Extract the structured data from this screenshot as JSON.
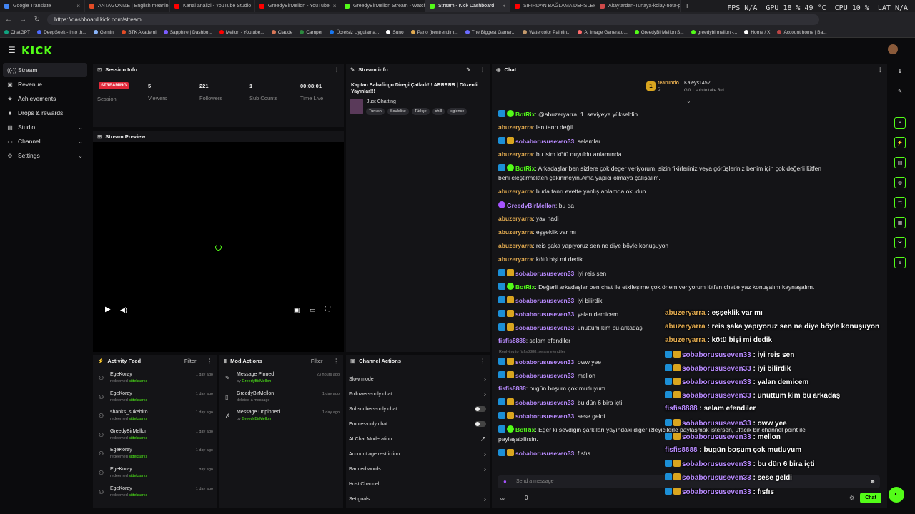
{
  "browser": {
    "tabs": [
      {
        "label": "Google Translate",
        "color": "#4285f4"
      },
      {
        "label": "ANTAGONIZE | English meaning -",
        "color": "#e34c26"
      },
      {
        "label": "Kanal analizi - YouTube Studio",
        "color": "#ff0000"
      },
      {
        "label": "GreedyBirMellon - YouTube",
        "color": "#ff0000"
      },
      {
        "label": "GreedyBirMellon Stream - Watch",
        "color": "#53fc18"
      },
      {
        "label": "Stream - Kick Dashboard",
        "color": "#53fc18",
        "active": true
      },
      {
        "label": "SIFIRDAN BAĞLAMA DERSLERİ 6 (",
        "color": "#ff0000"
      },
      {
        "label": "Altaylardan-Tunaya-kolay-nota-p",
        "color": "#d04a4a"
      }
    ],
    "url": "https://dashboard.kick.com/stream",
    "perf": {
      "fps_label": "FPS",
      "fps": "N/A",
      "gpu_label": "GPU",
      "gpu": "18 % 49 °C",
      "cpu_label": "CPU",
      "cpu": "10 %",
      "lat_label": "LAT",
      "lat": "N/A"
    },
    "bookmarks": [
      "ChatGPT",
      "DeepSeek - Into th...",
      "Gemini",
      "BTK Akademi",
      "Sapphire | Dashbo...",
      "Mellon - Youtube...",
      "Claude",
      "Camper",
      "Ücretsiz Uygulama...",
      "Suno",
      "Pano (bentrendim...",
      "The Biggest Gamer...",
      "Watercolor Paintin...",
      "AI Image Generato...",
      "GreedyBirMellon S...",
      "greedybirmellon -...",
      "Home / X",
      "Account home | Ba..."
    ]
  },
  "kick": {
    "logo": "KICK"
  },
  "sidebar": {
    "items": [
      {
        "label": "Stream",
        "icon": "radio-icon",
        "glyph": "((·))",
        "active": true
      },
      {
        "label": "Revenue",
        "icon": "dollar-icon",
        "glyph": "▣"
      },
      {
        "label": "Achievements",
        "icon": "trophy-icon",
        "glyph": "★"
      },
      {
        "label": "Drops & rewards",
        "icon": "gift-icon",
        "glyph": "■"
      },
      {
        "label": "Studio",
        "icon": "studio-icon",
        "glyph": "▤",
        "chevron": true
      },
      {
        "label": "Channel",
        "icon": "channel-icon",
        "glyph": "▭",
        "chevron": true
      },
      {
        "label": "Settings",
        "icon": "gear-icon",
        "glyph": "⚙",
        "chevron": true
      }
    ]
  },
  "session": {
    "title": "Session Info",
    "badge": "STREAMING",
    "session_label": "Session",
    "stats": [
      {
        "value": "5",
        "label": "Viewers"
      },
      {
        "value": "221",
        "label": "Followers"
      },
      {
        "value": "1",
        "label": "Sub Counts"
      },
      {
        "value": "00:08:01",
        "label": "Time Live"
      }
    ]
  },
  "preview": {
    "title": "Stream Preview"
  },
  "stream_info": {
    "title": "Stream info",
    "stream_title": "Kaptan Babafingo Diregi Çatladı!!! ARRRRR | Düzenli Yayınlar!!!",
    "category": "Just Chatting",
    "tags": [
      "Turkish",
      "Soulslike",
      "Türkçe",
      "chill",
      "eglence"
    ]
  },
  "activity": {
    "title": "Activity Feed",
    "filter": "Filter",
    "items": [
      {
        "name": "EgeKoray",
        "action": "redeemed",
        "target": "sitteksarkı",
        "time": "1 day ago"
      },
      {
        "name": "EgeKoray",
        "action": "redeemed",
        "target": "sitteksarkı",
        "time": "1 day ago"
      },
      {
        "name": "shanks_sukehiro",
        "action": "redeemed",
        "target": "sitteksarkı",
        "time": "1 day ago"
      },
      {
        "name": "GreedyBirMellon",
        "action": "redeemed",
        "target": "sitteksarkı",
        "time": "1 day ago"
      },
      {
        "name": "EgeKoray",
        "action": "redeemed",
        "target": "sitteksarkı",
        "time": "1 day ago"
      },
      {
        "name": "EgeKoray",
        "action": "redeemed",
        "target": "sitteksarkı",
        "time": "1 day ago"
      },
      {
        "name": "EgeKoray",
        "action": "redeemed",
        "target": "sitteksarkı",
        "time": "1 day ago"
      }
    ]
  },
  "mod_actions": {
    "title": "Mod Actions",
    "filter": "Filter",
    "items": [
      {
        "name": "Message Pinned",
        "detail_prefix": "by ",
        "detail": "GreedyBirMellon",
        "time": "23 hours ago",
        "icon": "pin-icon",
        "glyph": "✎"
      },
      {
        "name": "GreedyBirMellon",
        "detail_prefix": "",
        "detail": "deleted a message",
        "time": "1 day ago",
        "icon": "trash-icon",
        "glyph": "▯"
      },
      {
        "name": "Message Unpinned",
        "detail_prefix": "by ",
        "detail": "GreedyBirMellon",
        "time": "1 day ago",
        "icon": "unpin-icon",
        "glyph": "✗"
      }
    ]
  },
  "channel_actions": {
    "title": "Channel Actions",
    "items": [
      {
        "label": "Slow mode",
        "type": "chevron"
      },
      {
        "label": "Followers-only chat",
        "type": "chevron"
      },
      {
        "label": "Subscribers-only chat",
        "type": "toggle"
      },
      {
        "label": "Emotes-only chat",
        "type": "toggle"
      },
      {
        "label": "AI Chat Moderation",
        "type": "external"
      },
      {
        "label": "Account age restriction",
        "type": "chevron"
      },
      {
        "label": "Banned words",
        "type": "chevron"
      },
      {
        "label": "Host Channel",
        "type": "none"
      },
      {
        "label": "Set goals",
        "type": "chevron"
      }
    ]
  },
  "chat": {
    "title": "Chat",
    "gifter": {
      "rank": "1",
      "name": "tearundo",
      "count": "5"
    },
    "gift_user": "Kaleys1452",
    "gift_text": "Gift 1 sub to take 3rd",
    "reply_text": "Replying to fisfis8888: selam efendiler",
    "input_placeholder": "Send a message",
    "send": "Chat",
    "points": "0",
    "infinity": "∞",
    "messages": [
      {
        "user": "BotRix",
        "text": ": @abuzeryarra, 1. seviyeye yükseldin",
        "color": "#53fc18",
        "badges": [
          "mod",
          "ver"
        ]
      },
      {
        "user": "abuzeryarra",
        "text": ": lan tanrı değil",
        "color": "#e0a94f",
        "badges": []
      },
      {
        "user": "sobaborususeven33",
        "text": ": selamlar",
        "color": "#b98bff",
        "badges": [
          "mod",
          "sub"
        ]
      },
      {
        "user": "abuzeryarra",
        "text": ": bu isim kötü duyuldu anlamında",
        "color": "#e0a94f",
        "badges": []
      },
      {
        "user": "BotRix",
        "text": ": Arkadaşlar ben sizlere çok deger veriyorum, sizin fikirleriniz veya görüşleriniz benim için çok değerli lütfen",
        "text2": "beni eleştirmekten çekinmeyin.Ama yapıcı olmaya çalışalım.",
        "color": "#53fc18",
        "badges": [
          "mod",
          "ver"
        ]
      },
      {
        "user": "abuzeryarra",
        "text": ": buda tanrı evette yanlış anlamda okudun",
        "color": "#e0a94f",
        "badges": []
      },
      {
        "user": "GreedyBirMellon",
        "text": ": bu da",
        "color": "#b98bff",
        "badges": [
          "mic"
        ]
      },
      {
        "user": "abuzeryarra",
        "text": ": yav hadi",
        "color": "#e0a94f",
        "badges": []
      },
      {
        "user": "abuzeryarra",
        "text": ": eşşeklik var mı",
        "color": "#e0a94f",
        "badges": []
      },
      {
        "user": "abuzeryarra",
        "text": ": reis şaka yapıyoruz sen ne diye böyle konuşuyon",
        "color": "#e0a94f",
        "badges": []
      },
      {
        "user": "abuzeryarra",
        "text": ": kötü bişi mi dedik",
        "color": "#e0a94f",
        "badges": []
      },
      {
        "user": "sobaborususeven33",
        "text": ": iyi reis sen",
        "color": "#b98bff",
        "badges": [
          "mod",
          "sub"
        ]
      },
      {
        "user": "BotRix",
        "text": ": Değerli arkadaşlar ben chat ile etkileşime çok önem veriyorum lütfen chat'e yaz konuşalım kaynaşalım.",
        "color": "#53fc18",
        "badges": [
          "mod",
          "ver"
        ]
      },
      {
        "user": "sobaborususeven33",
        "text": ": iyi bilirdik",
        "color": "#b98bff",
        "badges": [
          "mod",
          "sub"
        ]
      },
      {
        "user": "sobaborususeven33",
        "text": ": yalan demicem",
        "color": "#b98bff",
        "badges": [
          "mod",
          "sub"
        ]
      },
      {
        "user": "sobaborususeven33",
        "text": ": unuttum kim bu arkadaş",
        "color": "#b98bff",
        "badges": [
          "mod",
          "sub"
        ]
      },
      {
        "user": "fisfis8888",
        "text": ": selam efendiler",
        "color": "#b98bff",
        "badges": []
      },
      {
        "user": "sobaborususeven33",
        "text": ": oww yee",
        "color": "#b98bff",
        "badges": [
          "mod",
          "sub"
        ]
      },
      {
        "user": "sobaborususeven33",
        "text": ": mellon",
        "color": "#b98bff",
        "badges": [
          "mod",
          "sub"
        ]
      },
      {
        "user": "fisfis8888",
        "text": ": bugün boşum çok mutluyum",
        "color": "#b98bff",
        "badges": []
      },
      {
        "user": "sobaborususeven33",
        "text": ": bu dün 6 bira içti",
        "color": "#b98bff",
        "badges": [
          "mod",
          "sub"
        ]
      },
      {
        "user": "sobaborususeven33",
        "text": ": sese geldi",
        "color": "#b98bff",
        "badges": [
          "mod",
          "sub"
        ]
      },
      {
        "user": "BotRix",
        "text": ": Eğer ki sevdiğin şarkıları yayındaki diğer izleyicilerle paylaşmak istersen, ufacık bir channel point ile",
        "text2": "paylaşabilirsin.",
        "color": "#53fc18",
        "badges": [
          "mod",
          "ver"
        ]
      },
      {
        "user": "sobaborususeven33",
        "text": ": fısfıs",
        "color": "#b98bff",
        "badges": [
          "mod",
          "sub"
        ]
      }
    ],
    "overlay": [
      {
        "user": "abuzeryarra",
        "text": " : eşşeklik var mı",
        "kind": "u",
        "badges": []
      },
      {
        "user": "abuzeryarra",
        "text": " : reis şaka yapıyoruz sen ne diye böyle konuşuyon",
        "kind": "u",
        "badges": []
      },
      {
        "user": "abuzeryarra",
        "text": " : kötü bişi mi dedik",
        "kind": "u",
        "badges": []
      },
      {
        "user": "sobaborususeven33",
        "text": " : iyi reis sen",
        "kind": "p",
        "badges": [
          "mod",
          "sub"
        ]
      },
      {
        "user": "sobaborususeven33",
        "text": " : iyi bilirdik",
        "kind": "p",
        "badges": [
          "mod",
          "sub"
        ]
      },
      {
        "user": "sobaborususeven33",
        "text": " : yalan demicem",
        "kind": "p",
        "badges": [
          "mod",
          "sub"
        ]
      },
      {
        "user": "sobaborususeven33",
        "text": " : unuttum kim bu arkadaş",
        "kind": "p",
        "badges": [
          "mod",
          "sub"
        ]
      },
      {
        "user": "fisfis8888",
        "text": " : selam efendiler",
        "kind": "p",
        "badges": []
      },
      {
        "user": "sobaborususeven33",
        "text": " : oww yee",
        "kind": "p",
        "badges": [
          "mod",
          "sub"
        ]
      },
      {
        "user": "sobaborususeven33",
        "text": " : mellon",
        "kind": "p",
        "badges": [
          "mod",
          "sub"
        ]
      },
      {
        "user": "fisfis8888",
        "text": " : bugün boşum çok mutluyum",
        "kind": "p",
        "badges": []
      },
      {
        "user": "sobaborususeven33",
        "text": " : bu dün 6 bira içti",
        "kind": "p",
        "badges": [
          "mod",
          "sub"
        ]
      },
      {
        "user": "sobaborususeven33",
        "text": " : sese geldi",
        "kind": "p",
        "badges": [
          "mod",
          "sub"
        ]
      },
      {
        "user": "sobaborususeven33",
        "text": " : fısfıs",
        "kind": "p",
        "badges": [
          "mod",
          "sub"
        ]
      }
    ]
  },
  "right_tools": [
    "info-icon",
    "wrench-icon",
    "crop-icon",
    "bolt-icon",
    "document-icon",
    "chat-bubble-icon",
    "code-icon",
    "stack-icon",
    "tool-icon",
    "share-icon"
  ],
  "colors": {
    "accent": "#53fc18",
    "live": "#e0293a"
  }
}
